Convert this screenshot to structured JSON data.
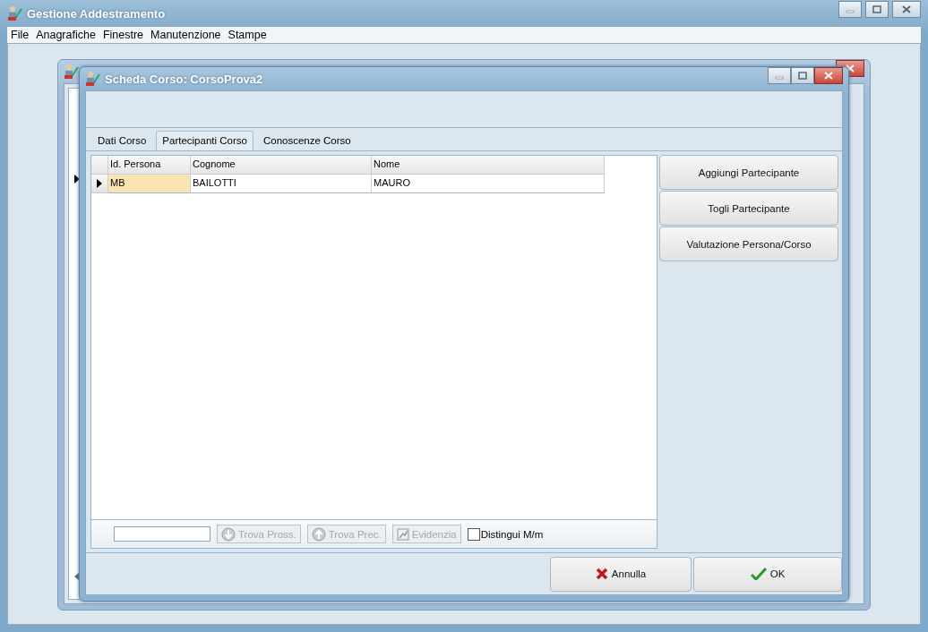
{
  "main_window": {
    "title": "Gestione Addestramento"
  },
  "menu": [
    "File",
    "Anagrafiche",
    "Finestre",
    "Manutenzione",
    "Stampe"
  ],
  "dialog": {
    "title": "Scheda Corso: CorsoProva2",
    "tabs": [
      {
        "label": "Dati Corso",
        "selected": false
      },
      {
        "label": "Partecipanti Corso",
        "selected": true
      },
      {
        "label": "Conoscenze Corso",
        "selected": false
      }
    ],
    "grid": {
      "columns": [
        "Id. Persona",
        "Cognome",
        "Nome"
      ],
      "rows": [
        {
          "current": true,
          "cells": [
            {
              "text": "MB",
              "selected": true
            },
            {
              "text": "BAILOTTI",
              "selected": false
            },
            {
              "text": "MAURO",
              "selected": false
            }
          ]
        }
      ]
    },
    "find_buttons": [
      {
        "label": "Trova Pross.",
        "kind": "down",
        "disabled": true
      },
      {
        "label": "Trova Prec.",
        "kind": "up",
        "disabled": true
      },
      {
        "label": "Evidenzia",
        "kind": "highlight",
        "disabled": true
      }
    ],
    "match_case": {
      "label": "Distingui M/m",
      "checked": false
    },
    "side_buttons": [
      "Aggiungi Partecipante",
      "Togli Partecipante",
      "Valutazione Persona/Corso"
    ],
    "footer_buttons": [
      {
        "label": "Annulla",
        "kind": "cancel"
      },
      {
        "label": "OK",
        "kind": "ok"
      }
    ]
  }
}
